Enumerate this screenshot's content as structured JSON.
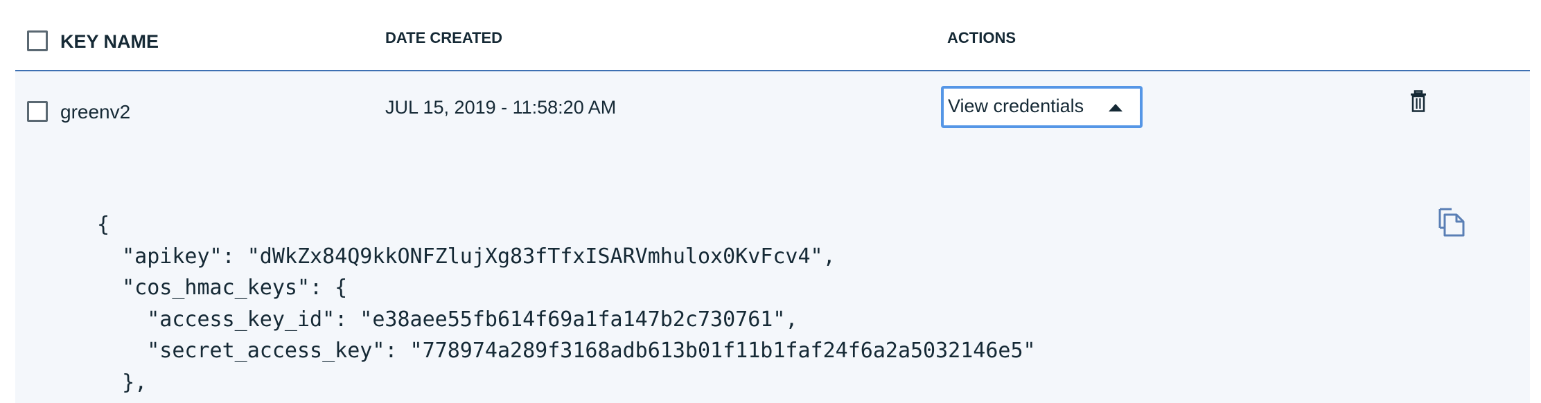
{
  "table": {
    "columns": {
      "key_name": "KEY NAME",
      "date_created": "DATE CREATED",
      "actions": "ACTIONS"
    },
    "row": {
      "key_name": "greenv2",
      "date_created": "JUL 15, 2019 - 11:58:20 AM",
      "action_label": "View credentials",
      "select_checked": false
    },
    "select_all_checked": false
  },
  "credentials": {
    "lines": [
      "{",
      "  \"apikey\": \"dWkZx84Q9kkONFZlujXg83fTfxISARVmhulox0KvFcv4\",",
      "  \"cos_hmac_keys\": {",
      "    \"access_key_id\": \"e38aee55fb614f69a1fa147b2c730761\",",
      "    \"secret_access_key\": \"778974a289f3168adb613b01f11b1faf24f6a2a5032146e5\"",
      "  },"
    ]
  },
  "icons": {
    "dropdown_caret": "caret-up-icon",
    "delete": "trash-icon",
    "copy": "copy-icon"
  },
  "colors": {
    "accent": "#3d70b2",
    "focus_border": "#5596e6",
    "row_background": "#f4f7fb",
    "text": "#152935",
    "icon_blue": "#5a7fb5"
  }
}
